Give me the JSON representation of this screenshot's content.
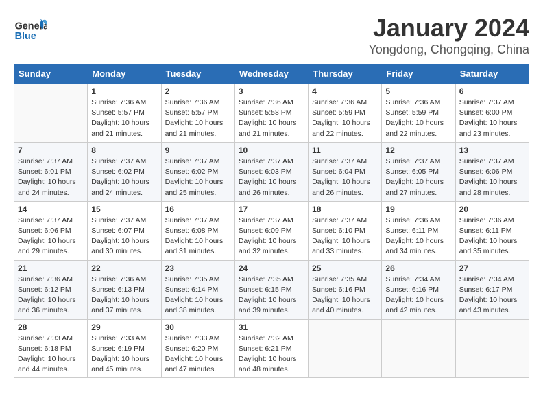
{
  "header": {
    "logo_general": "General",
    "logo_blue": "Blue",
    "month": "January 2024",
    "location": "Yongdong, Chongqing, China"
  },
  "weekdays": [
    "Sunday",
    "Monday",
    "Tuesday",
    "Wednesday",
    "Thursday",
    "Friday",
    "Saturday"
  ],
  "weeks": [
    [
      {
        "day": "",
        "info": ""
      },
      {
        "day": "1",
        "info": "Sunrise: 7:36 AM\nSunset: 5:57 PM\nDaylight: 10 hours\nand 21 minutes."
      },
      {
        "day": "2",
        "info": "Sunrise: 7:36 AM\nSunset: 5:57 PM\nDaylight: 10 hours\nand 21 minutes."
      },
      {
        "day": "3",
        "info": "Sunrise: 7:36 AM\nSunset: 5:58 PM\nDaylight: 10 hours\nand 21 minutes."
      },
      {
        "day": "4",
        "info": "Sunrise: 7:36 AM\nSunset: 5:59 PM\nDaylight: 10 hours\nand 22 minutes."
      },
      {
        "day": "5",
        "info": "Sunrise: 7:36 AM\nSunset: 5:59 PM\nDaylight: 10 hours\nand 22 minutes."
      },
      {
        "day": "6",
        "info": "Sunrise: 7:37 AM\nSunset: 6:00 PM\nDaylight: 10 hours\nand 23 minutes."
      }
    ],
    [
      {
        "day": "7",
        "info": "Sunrise: 7:37 AM\nSunset: 6:01 PM\nDaylight: 10 hours\nand 24 minutes."
      },
      {
        "day": "8",
        "info": "Sunrise: 7:37 AM\nSunset: 6:02 PM\nDaylight: 10 hours\nand 24 minutes."
      },
      {
        "day": "9",
        "info": "Sunrise: 7:37 AM\nSunset: 6:02 PM\nDaylight: 10 hours\nand 25 minutes."
      },
      {
        "day": "10",
        "info": "Sunrise: 7:37 AM\nSunset: 6:03 PM\nDaylight: 10 hours\nand 26 minutes."
      },
      {
        "day": "11",
        "info": "Sunrise: 7:37 AM\nSunset: 6:04 PM\nDaylight: 10 hours\nand 26 minutes."
      },
      {
        "day": "12",
        "info": "Sunrise: 7:37 AM\nSunset: 6:05 PM\nDaylight: 10 hours\nand 27 minutes."
      },
      {
        "day": "13",
        "info": "Sunrise: 7:37 AM\nSunset: 6:06 PM\nDaylight: 10 hours\nand 28 minutes."
      }
    ],
    [
      {
        "day": "14",
        "info": "Sunrise: 7:37 AM\nSunset: 6:06 PM\nDaylight: 10 hours\nand 29 minutes."
      },
      {
        "day": "15",
        "info": "Sunrise: 7:37 AM\nSunset: 6:07 PM\nDaylight: 10 hours\nand 30 minutes."
      },
      {
        "day": "16",
        "info": "Sunrise: 7:37 AM\nSunset: 6:08 PM\nDaylight: 10 hours\nand 31 minutes."
      },
      {
        "day": "17",
        "info": "Sunrise: 7:37 AM\nSunset: 6:09 PM\nDaylight: 10 hours\nand 32 minutes."
      },
      {
        "day": "18",
        "info": "Sunrise: 7:37 AM\nSunset: 6:10 PM\nDaylight: 10 hours\nand 33 minutes."
      },
      {
        "day": "19",
        "info": "Sunrise: 7:36 AM\nSunset: 6:11 PM\nDaylight: 10 hours\nand 34 minutes."
      },
      {
        "day": "20",
        "info": "Sunrise: 7:36 AM\nSunset: 6:11 PM\nDaylight: 10 hours\nand 35 minutes."
      }
    ],
    [
      {
        "day": "21",
        "info": "Sunrise: 7:36 AM\nSunset: 6:12 PM\nDaylight: 10 hours\nand 36 minutes."
      },
      {
        "day": "22",
        "info": "Sunrise: 7:36 AM\nSunset: 6:13 PM\nDaylight: 10 hours\nand 37 minutes."
      },
      {
        "day": "23",
        "info": "Sunrise: 7:35 AM\nSunset: 6:14 PM\nDaylight: 10 hours\nand 38 minutes."
      },
      {
        "day": "24",
        "info": "Sunrise: 7:35 AM\nSunset: 6:15 PM\nDaylight: 10 hours\nand 39 minutes."
      },
      {
        "day": "25",
        "info": "Sunrise: 7:35 AM\nSunset: 6:16 PM\nDaylight: 10 hours\nand 40 minutes."
      },
      {
        "day": "26",
        "info": "Sunrise: 7:34 AM\nSunset: 6:16 PM\nDaylight: 10 hours\nand 42 minutes."
      },
      {
        "day": "27",
        "info": "Sunrise: 7:34 AM\nSunset: 6:17 PM\nDaylight: 10 hours\nand 43 minutes."
      }
    ],
    [
      {
        "day": "28",
        "info": "Sunrise: 7:33 AM\nSunset: 6:18 PM\nDaylight: 10 hours\nand 44 minutes."
      },
      {
        "day": "29",
        "info": "Sunrise: 7:33 AM\nSunset: 6:19 PM\nDaylight: 10 hours\nand 45 minutes."
      },
      {
        "day": "30",
        "info": "Sunrise: 7:33 AM\nSunset: 6:20 PM\nDaylight: 10 hours\nand 47 minutes."
      },
      {
        "day": "31",
        "info": "Sunrise: 7:32 AM\nSunset: 6:21 PM\nDaylight: 10 hours\nand 48 minutes."
      },
      {
        "day": "",
        "info": ""
      },
      {
        "day": "",
        "info": ""
      },
      {
        "day": "",
        "info": ""
      }
    ]
  ]
}
